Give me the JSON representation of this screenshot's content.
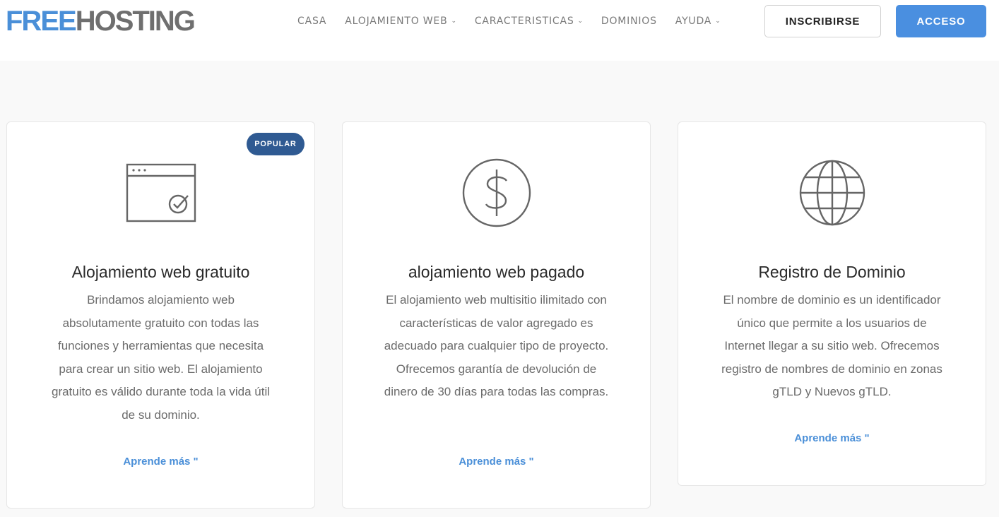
{
  "header": {
    "logo": {
      "part1": "FREE",
      "part2": "HOSTING"
    },
    "nav": {
      "casa": "CASA",
      "alojamiento_web": "ALOJAMIENTO WEB",
      "caracteristicas": "CARACTERISTICAS",
      "dominios": "DOMINIOS",
      "ayuda": "AYUDA"
    },
    "signup_label": "INSCRIBIRSE",
    "login_label": "ACCESO"
  },
  "colors": {
    "brand_blue": "#4a8fd8",
    "badge_blue": "#2f5a92",
    "text_gray": "#6b6b6b"
  },
  "cards": [
    {
      "badge": "POPULAR",
      "icon": "browser-check-icon",
      "title": "Alojamiento web gratuito",
      "description": "Brindamos alojamiento web absolutamente gratuito con todas las funciones y herramientas que necesita para crear un sitio web. El alojamiento gratuito es válido durante toda la vida útil de su dominio.",
      "link": "Aprende más \""
    },
    {
      "icon": "dollar-coin-icon",
      "title": "alojamiento web pagado",
      "description": "El alojamiento web multisitio ilimitado con características de valor agregado es adecuado para cualquier tipo de proyecto. Ofrecemos garantía de devolución de dinero de 30 días para todas las compras.",
      "link": "Aprende más \""
    },
    {
      "icon": "globe-icon",
      "title": "Registro de Dominio",
      "description": "El nombre de dominio es un identificador único que permite a los usuarios de Internet llegar a su sitio web. Ofrecemos registro de nombres de dominio en zonas gTLD y Nuevos gTLD.",
      "link": "Aprende más \""
    }
  ]
}
